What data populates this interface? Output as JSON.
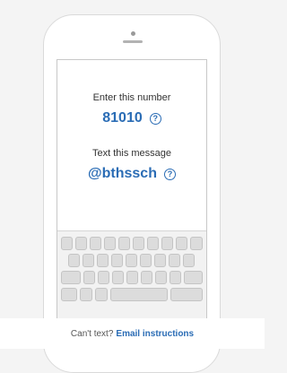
{
  "instructions": {
    "enter_number_label": "Enter this number",
    "number": "81010",
    "text_message_label": "Text this message",
    "message": "@bthssch",
    "help_glyph": "?"
  },
  "footer": {
    "question": "Can't text?",
    "link": "Email instructions"
  },
  "colors": {
    "accent": "#2a6cb5",
    "background": "#f4f4f4"
  }
}
